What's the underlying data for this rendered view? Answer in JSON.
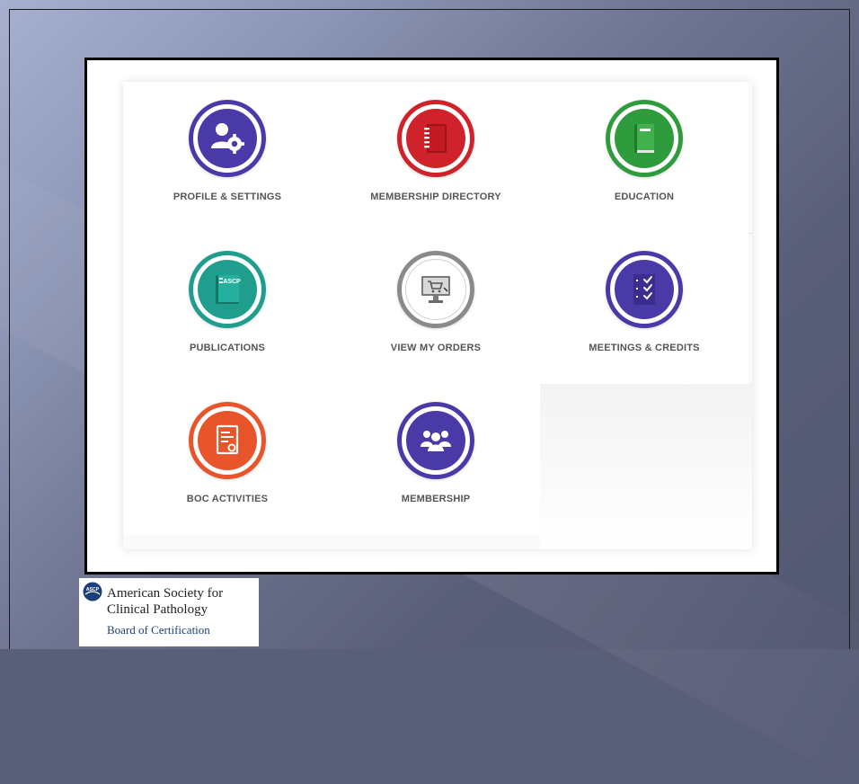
{
  "tiles": [
    {
      "label": "PROFILE & SETTINGS",
      "icon": "user-settings-icon",
      "color": "#4a3aa8"
    },
    {
      "label": "MEMBERSHIP DIRECTORY",
      "icon": "notebook-icon",
      "color": "#d0222a"
    },
    {
      "label": "EDUCATION",
      "icon": "book-icon",
      "color": "#2e9c3c"
    },
    {
      "label": "PUBLICATIONS",
      "icon": "ascp-book-icon",
      "color": "#1f9e8e"
    },
    {
      "label": "VIEW MY ORDERS",
      "icon": "computer-cart-icon",
      "color": "#8a8a8a"
    },
    {
      "label": "MEETINGS & CREDITS",
      "icon": "checklist-icon",
      "color": "#4a3aa8"
    },
    {
      "label": "BOC ACTIVITIES",
      "icon": "certificate-icon",
      "color": "#e8552a"
    },
    {
      "label": "MEMBERSHIP",
      "icon": "group-icon",
      "color": "#4a3aa8"
    }
  ],
  "book_badge": "ASCP",
  "logo": {
    "seal_text": "ASCP",
    "line1": "American Society for",
    "line2": "Clinical Pathology",
    "line3": "Board of Certification"
  }
}
